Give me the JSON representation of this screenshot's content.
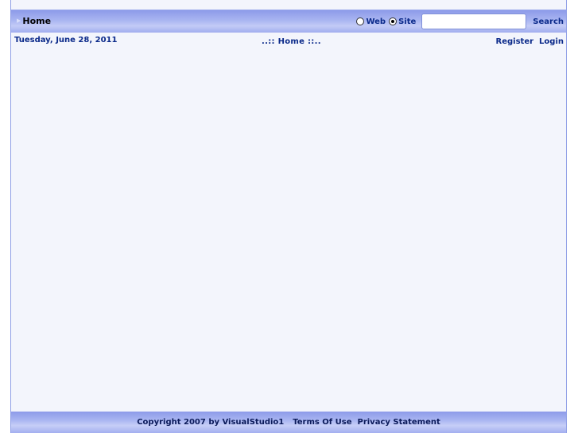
{
  "menu": {
    "home_label": "Home",
    "home_arrow_icon": "right-triangle-icon"
  },
  "search": {
    "options": [
      {
        "label": "Web",
        "selected": false
      },
      {
        "label": "Site",
        "selected": true
      }
    ],
    "input_value": "",
    "button_label": "Search"
  },
  "header": {
    "date": "Tuesday, June 28, 2011",
    "page_title": "..:: Home ::..",
    "register_label": "Register",
    "login_label": "Login"
  },
  "footer": {
    "copyright": "Copyright 2007 by VisualStudio1",
    "terms_label": "Terms Of Use",
    "privacy_label": "Privacy Statement"
  },
  "colors": {
    "bar_dark": "#8d9be9",
    "bar_light": "#c3cbf6",
    "link": "#0b2a8a",
    "page_bg": "#f3f5fc"
  }
}
